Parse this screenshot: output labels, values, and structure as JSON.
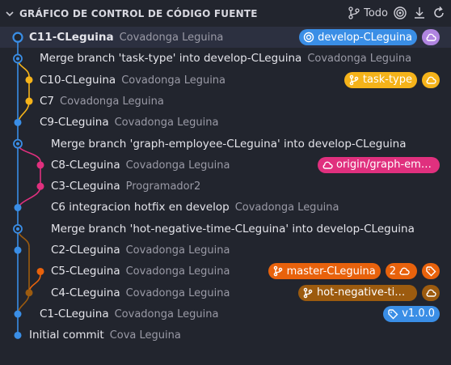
{
  "header": {
    "title": "GRÁFICO DE CONTROL DE CÓDIGO FUENTE",
    "filter_label": "Todo",
    "icons": [
      "chevron-down-icon",
      "branch-icon",
      "target-icon",
      "fetch-icon",
      "refresh-icon"
    ]
  },
  "colors": {
    "blue": "#3a8ee6",
    "purple": "#b084e0",
    "yellow": "#f5b31a",
    "pink": "#e0307e",
    "orange": "#e8620c",
    "brown": "#9c5b0f",
    "background": "#22252e"
  },
  "commits": [
    {
      "subject": "C11-CLeguina",
      "author": "Covadonga Leguina",
      "refs": [
        {
          "type": "branch-current",
          "label": "develop-CLeguina",
          "color": "#3a8ee6"
        },
        {
          "type": "cloud",
          "label": "",
          "color": "#b084e0"
        }
      ]
    },
    {
      "subject": "Merge branch 'task-type' into develop-CLeguina",
      "author": "Covadonga Leguina",
      "refs": []
    },
    {
      "subject": "C10-CLeguina",
      "author": "Covadonga Leguina",
      "refs": [
        {
          "type": "branch",
          "label": "task-type",
          "color": "#f5b31a"
        },
        {
          "type": "cloud",
          "label": "",
          "color": "#f5b31a"
        }
      ]
    },
    {
      "subject": "C7",
      "author": "Covadonga Leguina",
      "refs": []
    },
    {
      "subject": "C9-CLeguina",
      "author": "Covadonga Leguina",
      "refs": []
    },
    {
      "subject": "Merge branch 'graph-employee-CLeguina' into develop-CLeguina",
      "author": "",
      "refs": []
    },
    {
      "subject": "C8-CLeguina",
      "author": "Covadonga Leguina",
      "refs": [
        {
          "type": "remote",
          "label": "origin/graph-employee-CLeguina",
          "color": "#e0307e"
        }
      ]
    },
    {
      "subject": "C3-CLeguina",
      "author": "Programador2",
      "refs": []
    },
    {
      "subject": "C6 integracion hotfix en develop",
      "author": "Covadonga Leguina",
      "refs": []
    },
    {
      "subject": "Merge branch 'hot-negative-time-CLeguina' into develop-CLeguina",
      "author": "",
      "refs": []
    },
    {
      "subject": "C2-CLeguina",
      "author": "Covadonga Leguina",
      "refs": []
    },
    {
      "subject": "C5-CLeguina",
      "author": "Covadonga Leguina",
      "refs": [
        {
          "type": "branch",
          "label": "master-CLeguina",
          "color": "#e8620c"
        },
        {
          "type": "cloud",
          "label": "2",
          "color": "#e8620c"
        },
        {
          "type": "tag",
          "label": "",
          "color": "#e8620c"
        }
      ]
    },
    {
      "subject": "C4-CLeguina",
      "author": "Covadonga Leguina",
      "refs": [
        {
          "type": "branch",
          "label": "hot-negative-time-CLeguina",
          "color": "#9c5b0f"
        },
        {
          "type": "cloud",
          "label": "",
          "color": "#9c5b0f"
        }
      ]
    },
    {
      "subject": "C1-CLeguina",
      "author": "Covadonga Leguina",
      "refs": [
        {
          "type": "tag",
          "label": "v1.0.0",
          "color": "#3a8ee6"
        }
      ]
    },
    {
      "subject": "Initial commit",
      "author": "Cova Leguina",
      "refs": []
    }
  ]
}
